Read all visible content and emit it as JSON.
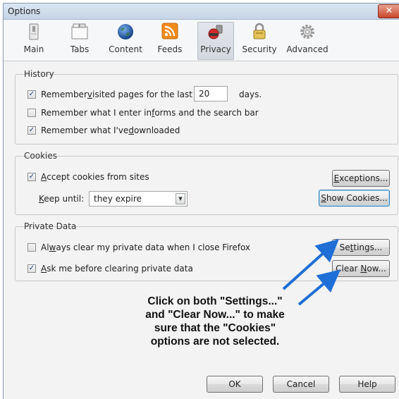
{
  "window": {
    "title": "Options",
    "close_glyph": "✕"
  },
  "toolbar": {
    "tabs": [
      {
        "label": "Main",
        "icon": "switch-icon"
      },
      {
        "label": "Tabs",
        "icon": "tabs-icon"
      },
      {
        "label": "Content",
        "icon": "globe-icon"
      },
      {
        "label": "Feeds",
        "icon": "rss-feed-icon"
      },
      {
        "label": "Privacy",
        "icon": "privacy-mask-icon"
      },
      {
        "label": "Security",
        "icon": "padlock-icon"
      },
      {
        "label": "Advanced",
        "icon": "gear-icon"
      }
    ],
    "selected": "Privacy"
  },
  "history": {
    "title": "History",
    "remember_pages": {
      "pre": "Remember ",
      "ul": "v",
      "post": "isited pages for the last",
      "checked": true
    },
    "days_value": "20",
    "days_label": "days.",
    "remember_forms": {
      "pre": "Remember what I enter in ",
      "ul": "f",
      "post": "orms and the search bar",
      "checked": false
    },
    "remember_downloads": {
      "pre": "Remember what I've ",
      "ul": "d",
      "post": "ownloaded",
      "checked": true
    }
  },
  "cookies": {
    "title": "Cookies",
    "accept": {
      "pre": "",
      "ul": "A",
      "post": "ccept cookies from sites",
      "checked": true
    },
    "keep_until": {
      "ul": "K",
      "post": "eep until:"
    },
    "keep_until_value": "they expire",
    "exceptions_button": {
      "ul": "E",
      "post": "xceptions..."
    },
    "show_cookies_button": {
      "ul": "S",
      "post": "how Cookies..."
    }
  },
  "private_data": {
    "title": "Private Data",
    "always_clear": {
      "pre": "Al",
      "ul": "w",
      "post": "ays clear my private data when I close Firefox",
      "checked": false
    },
    "ask_before": {
      "pre": "",
      "ul": "A",
      "post": "sk me before clearing private data",
      "checked": true
    },
    "settings_button": {
      "pre": "Se",
      "ul": "t",
      "post": "tings..."
    },
    "clear_now_button": {
      "pre": "Clear ",
      "ul": "N",
      "post": "ow..."
    }
  },
  "annotation": {
    "lines": [
      "Click on both \"Settings...\"",
      "and \"Clear Now...\" to make",
      "sure that the \"Cookies\"",
      "options are not selected."
    ],
    "arrow_color": "#1f6fd6"
  },
  "footer": {
    "ok": "OK",
    "cancel": "Cancel",
    "help": "Help"
  },
  "colors": {
    "check": "#1b3f7a",
    "focus_border": "#3c7fb1"
  }
}
